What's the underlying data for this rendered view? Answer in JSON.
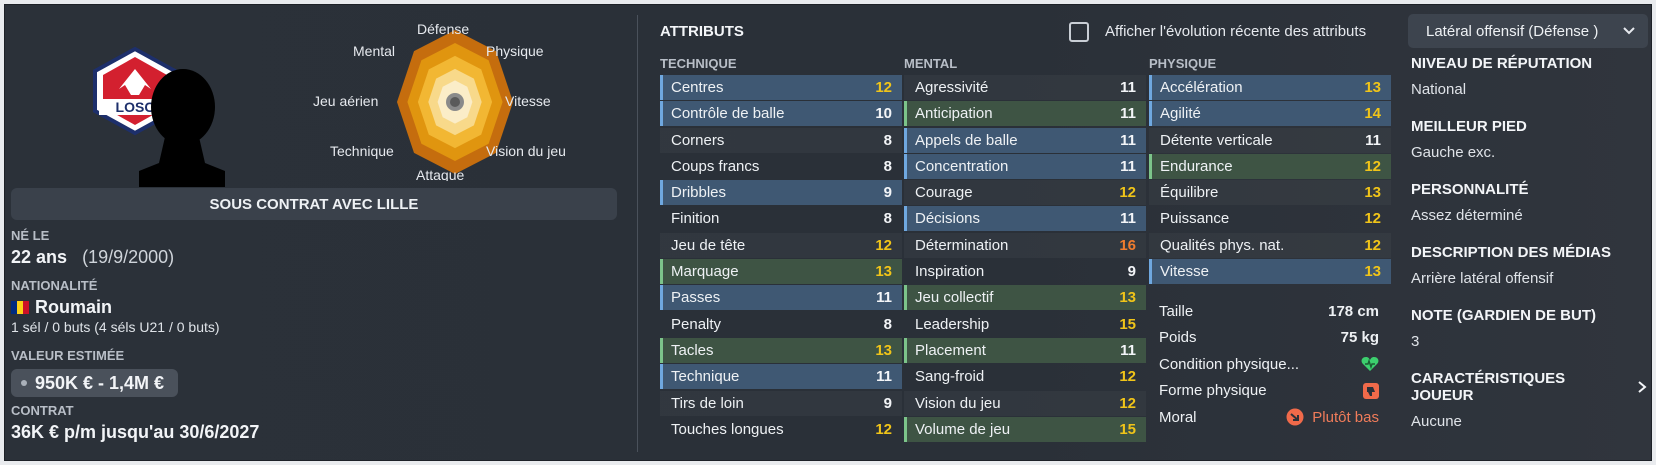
{
  "radar": {
    "labels": {
      "top": "Défense",
      "top_right": "Physique",
      "right": "Vitesse",
      "bottom_right": "Vision du jeu",
      "bottom": "Attaque",
      "bottom_left": "Technique",
      "left": "Jeu aérien",
      "top_left": "Mental"
    },
    "colors": [
      "#c56d0e",
      "#e0950f",
      "#f2b733",
      "#f8d98a",
      "#fbedc8"
    ]
  },
  "club": {
    "logo_text": "LOSC",
    "logo_icon": "lille-club-crest"
  },
  "contract_banner": "SOUS CONTRAT AVEC LILLE",
  "born": {
    "label": "NÉ LE",
    "age": "22 ans",
    "date": "(19/9/2000)"
  },
  "nationality": {
    "label": "NATIONALITÉ",
    "country": "Roumain",
    "flag_icon": "romania-flag",
    "caps": "1 sél / 0 buts (4 séls U21 / 0 buts)"
  },
  "value": {
    "label": "VALEUR ESTIMÉE",
    "amount": "950K € - 1,4M €"
  },
  "contract": {
    "label": "CONTRAT",
    "terms": "36K € p/m jusqu'au 30/6/2027"
  },
  "attributes": {
    "title": "ATTRIBUTS",
    "show_evolution_label": "Afficher l'évolution récente des attributs",
    "show_evolution_checked": false,
    "role": "Latéral offensif (Défense )",
    "technique": {
      "heading": "TECHNIQUE",
      "rows": [
        {
          "name": "Centres",
          "value": "12",
          "key": "blue"
        },
        {
          "name": "Contrôle de balle",
          "value": "10",
          "key": "blue"
        },
        {
          "name": "Corners",
          "value": "8",
          "key": ""
        },
        {
          "name": "Coups francs",
          "value": "8",
          "key": ""
        },
        {
          "name": "Dribbles",
          "value": "9",
          "key": "blue"
        },
        {
          "name": "Finition",
          "value": "8",
          "key": ""
        },
        {
          "name": "Jeu de tête",
          "value": "12",
          "key": ""
        },
        {
          "name": "Marquage",
          "value": "13",
          "key": "green"
        },
        {
          "name": "Passes",
          "value": "11",
          "key": "blue"
        },
        {
          "name": "Penalty",
          "value": "8",
          "key": ""
        },
        {
          "name": "Tacles",
          "value": "13",
          "key": "green"
        },
        {
          "name": "Technique",
          "value": "11",
          "key": "blue"
        },
        {
          "name": "Tirs de loin",
          "value": "9",
          "key": ""
        },
        {
          "name": "Touches longues",
          "value": "12",
          "key": ""
        }
      ]
    },
    "mental": {
      "heading": "MENTAL",
      "rows": [
        {
          "name": "Agressivité",
          "value": "11",
          "key": ""
        },
        {
          "name": "Anticipation",
          "value": "11",
          "key": "green"
        },
        {
          "name": "Appels de balle",
          "value": "11",
          "key": "blue"
        },
        {
          "name": "Concentration",
          "value": "11",
          "key": "blue"
        },
        {
          "name": "Courage",
          "value": "12",
          "key": ""
        },
        {
          "name": "Décisions",
          "value": "11",
          "key": "blue"
        },
        {
          "name": "Détermination",
          "value": "16",
          "key": ""
        },
        {
          "name": "Inspiration",
          "value": "9",
          "key": ""
        },
        {
          "name": "Jeu collectif",
          "value": "13",
          "key": "green"
        },
        {
          "name": "Leadership",
          "value": "15",
          "key": ""
        },
        {
          "name": "Placement",
          "value": "11",
          "key": "green"
        },
        {
          "name": "Sang-froid",
          "value": "12",
          "key": ""
        },
        {
          "name": "Vision du jeu",
          "value": "12",
          "key": ""
        },
        {
          "name": "Volume de jeu",
          "value": "15",
          "key": "green"
        }
      ]
    },
    "physique": {
      "heading": "PHYSIQUE",
      "rows": [
        {
          "name": "Accélération",
          "value": "13",
          "key": "blue"
        },
        {
          "name": "Agilité",
          "value": "14",
          "key": "blue"
        },
        {
          "name": "Détente verticale",
          "value": "11",
          "key": ""
        },
        {
          "name": "Endurance",
          "value": "12",
          "key": "green"
        },
        {
          "name": "Équilibre",
          "value": "13",
          "key": ""
        },
        {
          "name": "Puissance",
          "value": "12",
          "key": ""
        },
        {
          "name": "Qualités phys. nat.",
          "value": "12",
          "key": ""
        },
        {
          "name": "Vitesse",
          "value": "13",
          "key": "blue"
        }
      ]
    },
    "details": {
      "height_label": "Taille",
      "height": "178 cm",
      "weight_label": "Poids",
      "weight": "75 kg",
      "condition_label": "Condition physique...",
      "condition_icon": "heart-icon",
      "form_label": "Forme physique",
      "form_icon": "thumbs-down-icon",
      "morale_label": "Moral",
      "morale": "Plutôt bas",
      "morale_icon": "arrow-down-icon"
    }
  },
  "profile": {
    "reputation_label": "NIVEAU DE RÉPUTATION",
    "reputation": "National",
    "foot_label": "MEILLEUR PIED",
    "foot": "Gauche exc.",
    "personality_label": "PERSONNALITÉ",
    "personality": "Assez déterminé",
    "media_label": "DESCRIPTION DES MÉDIAS",
    "media": "Arrière latéral offensif",
    "gk_label": "NOTE (GARDIEN DE BUT)",
    "gk": "3",
    "traits_label": "CARACTÉRISTIQUES JOUEUR",
    "traits": "Aucune"
  }
}
